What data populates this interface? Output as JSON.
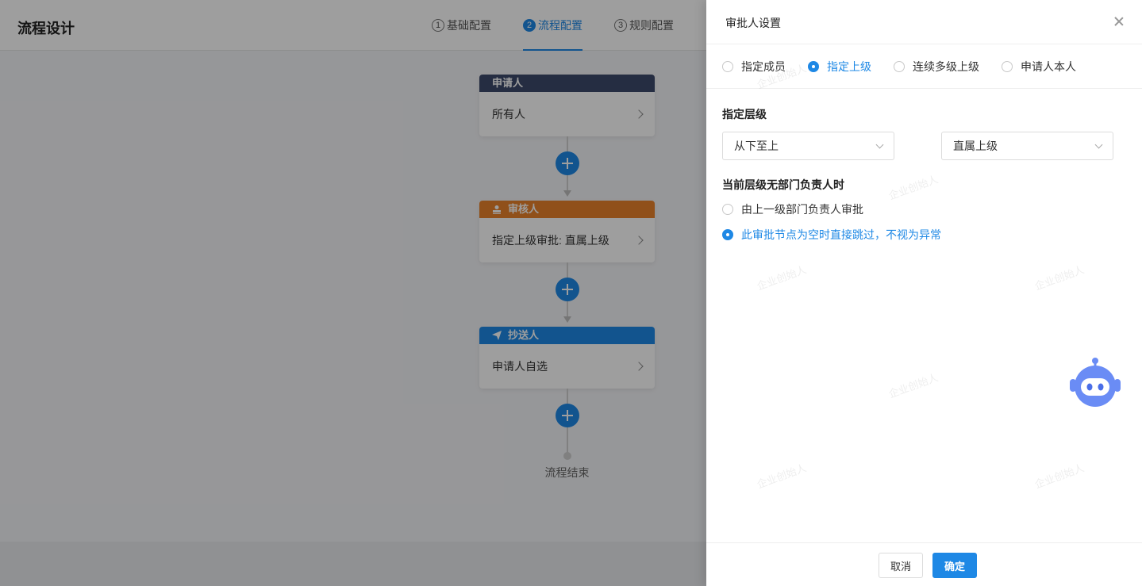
{
  "page": {
    "title": "流程设计",
    "steps": [
      {
        "num": "1",
        "label": "基础配置"
      },
      {
        "num": "2",
        "label": "流程配置"
      },
      {
        "num": "3",
        "label": "规则配置"
      }
    ],
    "flow": {
      "nodes": [
        {
          "header": "申请人",
          "body": "所有人",
          "color": "#3c4a6b"
        },
        {
          "header": "审核人",
          "body": "指定上级审批: 直属上级",
          "color": "#e8822a"
        },
        {
          "header": "抄送人",
          "body": "申请人自选",
          "color": "#1e88e5"
        }
      ],
      "end_label": "流程结束"
    }
  },
  "drawer": {
    "title": "审批人设置",
    "approver_types": [
      "指定成员",
      "指定上级",
      "连续多级上级",
      "申请人本人"
    ],
    "selected_type_index": 1,
    "level_section_title": "指定层级",
    "direction_select": "从下至上",
    "level_select": "直属上级",
    "no_head_title": "当前层级无部门负责人时",
    "no_head_options": [
      "由上一级部门负责人审批",
      "此审批节点为空时直接跳过，不视为异常"
    ],
    "selected_no_head_index": 1,
    "watermark": "企业创始人",
    "cancel_label": "取消",
    "ok_label": "确定"
  },
  "colors": {
    "accent": "#1e88e5"
  }
}
